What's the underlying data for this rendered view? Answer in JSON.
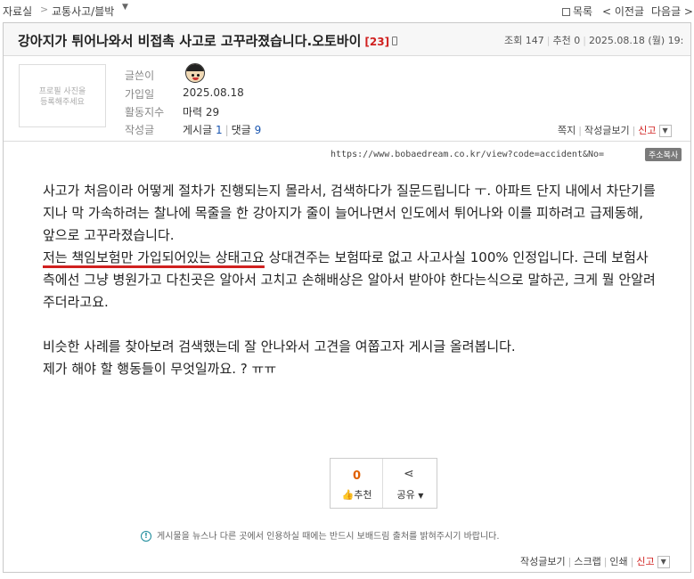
{
  "breadcrumb": {
    "root": "자료실",
    "separator": ">",
    "category": "교통사고/블박"
  },
  "nav": {
    "list": "목록",
    "prev": "< 이전글",
    "next": "다음글 >"
  },
  "post": {
    "title": "강아지가 튀어나와서 비접촉 사고로 고꾸라졌습니다.오토바이",
    "comment_count": "[23]",
    "views_label": "조회",
    "views": "147",
    "recommend_label": "추천",
    "recommend": "0",
    "date": "2025.08.18 (월) 19:"
  },
  "author": {
    "profile_placeholder_line1": "프로필 사진을",
    "profile_placeholder_line2": "등록해주세요",
    "writer_label": "글쓴이",
    "joined_label": "가입일",
    "joined": "2025.08.18",
    "activity_label": "활동지수",
    "activity": "마력 29",
    "posts_label": "작성글",
    "posts_text": "게시글",
    "posts_count": "1",
    "comments_text": "댓글",
    "comments_count": "9"
  },
  "author_actions": {
    "message": "쪽지",
    "view_posts": "작성글보기",
    "report": "신고"
  },
  "url": "https://www.bobaedream.co.kr/view?code=accident&No=",
  "copy_button": "주소복사",
  "content": {
    "p1": "사고가 처음이라 어떻게 절차가 진행되는지 몰라서, 검색하다가 질문드립니다 ㅜ. 아파트 단지 내에서 차단기를 지나 막 가속하려는 찰나에 목줄을 한 강아지가 줄이 늘어나면서 인도에서 튀어나와 이를 피하려고 급제동해, 앞으로 고꾸라졌습니다.",
    "p2_underlined": "저는 책임보험만 가입되어있는 상태고요",
    "p2_rest": " 상대견주는 보험따로 없고 사고사실 100% 인정입니다. 근데 보험사측에선 그냥 병원가고 다친곳은 알아서 고치고 손해배상은 알아서 받아야 한다는식으로 말하곤, 크게 뭘 안알려주더라고요.",
    "p3": "비슷한 사례를 찾아보려 검색했는데 잘 안나와서 고견을 여쭙고자 게시글 올려봅니다.",
    "p4": "제가 해야 할 행동들이 무엇일까요. ? ㅠㅠ"
  },
  "vote": {
    "count": "0",
    "label": "추천"
  },
  "share": {
    "label": "공유"
  },
  "notice": "게시물을 뉴스나 다른 곳에서 인용하실 때에는 반드시 보배드림 출처를 밝혀주시기 바랍니다.",
  "bottom_actions": {
    "view_posts": "작성글보기",
    "scrap": "스크랩",
    "print": "인쇄",
    "report": "신고"
  },
  "colors": {
    "accent_red": "#d0201f",
    "link_blue": "#1a56b0",
    "vote_orange": "#e06000"
  }
}
